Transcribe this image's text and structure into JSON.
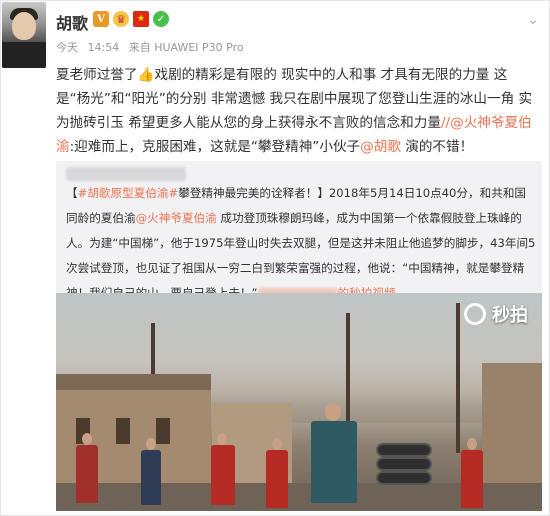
{
  "post": {
    "username": "胡歌",
    "badges": {
      "verified": "V",
      "crown": "♛",
      "flag": "★",
      "circle": "✓"
    },
    "meta": {
      "date": "今天",
      "time": "14:54",
      "source": "来自 HUAWEI P30 Pro"
    },
    "content_parts": [
      "夏老师过誉了",
      "👍",
      "戏剧的精彩是有限的 现实中的人和事 才具有无限的力量 这是“杨光”和“阳光”的分别 非常遗憾 我只在剧中展现了您登山生涯的冰山一角 实为抛砖引玉 希望更多人能从您的身上获得永不言败的信念和力量",
      "//@火神爷夏伯渝",
      ":迎难而上，克服困难，这就是“攀登精神”小伙子",
      "@胡歌",
      " 演的不错！"
    ]
  },
  "repost": {
    "topic1": "#胡歌原型夏伯渝#",
    "topic1_rest": "攀登精神最完美的诠释者！】2018年5月14日10点40分，和共和国同龄的夏伯渝",
    "bracket_open": "【",
    "at_name": "@火神爷夏伯渝",
    "text2": " 成功登顶珠穆朗玛峰，成为中国第一个依靠假肢登上珠峰的人。为建“中国梯”，他于1975年登山时失去双腿，但是这并未阻止他追梦的脚步，43年间5次尝试登顶，也见证了祖国从一穷二白到繁荣富强的过程，他说：“中国精神，就是攀登精神！我们自己的山，要自己登上去！”",
    "video_link": "的秒拍视频",
    "watermark": "秒拍"
  },
  "colors": {
    "accent": "#eb7350",
    "repost_bg": "#f2f2f5",
    "meta": "#999999"
  }
}
